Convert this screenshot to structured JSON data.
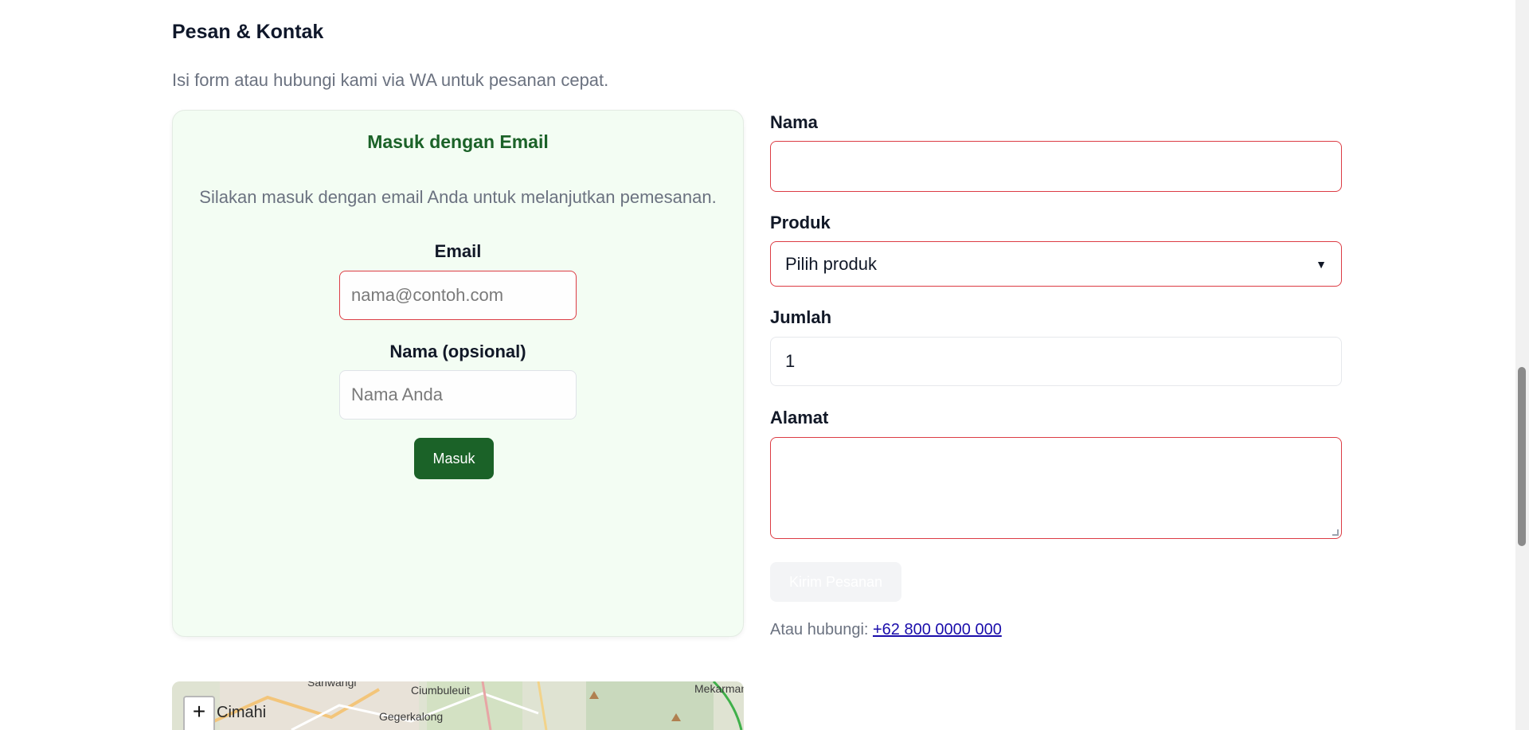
{
  "section": {
    "title": "Pesan & Kontak",
    "subtitle": "Isi form atau hubungi kami via WA untuk pesanan cepat."
  },
  "login": {
    "title": "Masuk dengan Email",
    "description": "Silakan masuk dengan email Anda untuk melanjutkan pemesanan.",
    "email_label": "Email",
    "email_placeholder": "nama@contoh.com",
    "name_label": "Nama (opsional)",
    "name_placeholder": "Nama Anda",
    "submit_label": "Masuk"
  },
  "order": {
    "name_label": "Nama",
    "name_value": "",
    "product_label": "Produk",
    "product_selected": "Pilih produk",
    "quantity_label": "Jumlah",
    "quantity_value": "1",
    "address_label": "Alamat",
    "address_value": "",
    "submit_label": "Kirim Pesanan",
    "submit_disabled": true
  },
  "contact": {
    "prefix": "Atau hubungi:",
    "phone": "+62 800 0000 000"
  },
  "map": {
    "zoom_in": "+",
    "labels": [
      "Cimahi",
      "Ciumbuleuit",
      "Gegerkalong",
      "Sariwangi",
      "Mekarmanik"
    ]
  },
  "colors": {
    "accent": "#1b6228",
    "invalid_border": "#dc3c44",
    "card_bg": "#f3fdf3"
  }
}
